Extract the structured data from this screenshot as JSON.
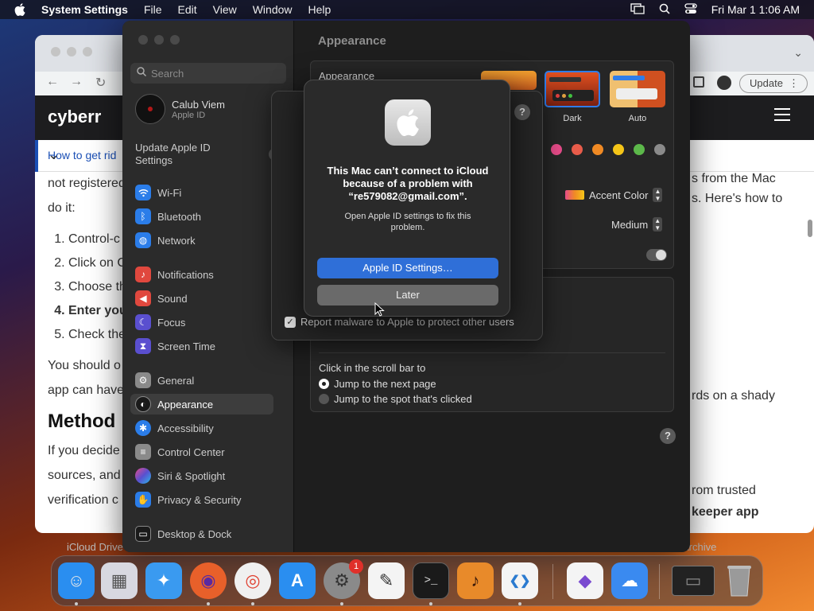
{
  "menubar": {
    "app_name": "System Settings",
    "items": [
      "File",
      "Edit",
      "View",
      "Window",
      "Help"
    ],
    "clock": "Fri Mar 1  1:06 AM"
  },
  "browser": {
    "update_label": "Update",
    "site_logo": "cyberr",
    "breadcrumb": "How to get rid",
    "article": {
      "p1": "not registered… App Store or",
      "p1b": "do it:",
      "steps": [
        "Control-c",
        "Click on C",
        "Choose th",
        "Enter you",
        "Check the"
      ],
      "p2": "You should o",
      "p2b": "app can have",
      "heading": "Method",
      "p3": "If you decide",
      "p3b": "sources, and",
      "p3c": "verification c",
      "right1": "s from the Mac",
      "right2": "s. Here's how to",
      "right3": "rds on a shady",
      "right4": "rom trusted",
      "right5": "keeper app"
    },
    "footer_left": "iCloud Drive",
    "footer_right": "Archive"
  },
  "settings": {
    "search_placeholder": "Search",
    "user_name": "Calub Viem",
    "user_sub": "Apple ID",
    "update_apple_id": "Update Apple ID Settings",
    "update_badge": "1",
    "nav": [
      {
        "label": "Wi-Fi",
        "icon": "wifi-icon",
        "color": "#2b7de9"
      },
      {
        "label": "Bluetooth",
        "icon": "bluetooth-icon",
        "color": "#2b7de9"
      },
      {
        "label": "Network",
        "icon": "globe-icon",
        "color": "#2b7de9"
      },
      {
        "label": "Notifications",
        "icon": "bell-icon",
        "color": "#e0483e"
      },
      {
        "label": "Sound",
        "icon": "speaker-icon",
        "color": "#e0483e"
      },
      {
        "label": "Focus",
        "icon": "moon-icon",
        "color": "#5a4fcf"
      },
      {
        "label": "Screen Time",
        "icon": "hourglass-icon",
        "color": "#5a4fcf"
      },
      {
        "label": "General",
        "icon": "gear-icon",
        "color": "#8a8a8a"
      },
      {
        "label": "Appearance",
        "icon": "appearance-icon",
        "color": "#1a1a1a"
      },
      {
        "label": "Accessibility",
        "icon": "accessibility-icon",
        "color": "#2b7de9"
      },
      {
        "label": "Control Center",
        "icon": "control-center-icon",
        "color": "#8a8a8a"
      },
      {
        "label": "Siri & Spotlight",
        "icon": "siri-icon",
        "color": "#b04fd0"
      },
      {
        "label": "Privacy & Security",
        "icon": "hand-icon",
        "color": "#2b7de9"
      },
      {
        "label": "Desktop & Dock",
        "icon": "dock-icon",
        "color": "#1a1a1a"
      }
    ],
    "page_title": "Appearance",
    "appearance_label": "Appearance",
    "theme_dark": "Dark",
    "theme_auto": "Auto",
    "accent_label": "Accent Color",
    "medium_label": "Medium",
    "scroll_title": "Click in the scroll bar to",
    "scroll_opt1": "Jump to the next page",
    "scroll_opt2": "Jump to the spot that's clicked",
    "accent_colors": [
      "#e84c8a",
      "#e85c4a",
      "#f08a24",
      "#f5c518",
      "#5cb84a",
      "#8a8a8a"
    ]
  },
  "sheet": {
    "report_label": "Report malware to Apple to protect other users"
  },
  "alert": {
    "headline": "This Mac can’t connect to iCloud because of a problem with “re579082@gmail.com”.",
    "message": "Open Apple ID settings to fix this problem.",
    "primary": "Apple ID Settings…",
    "secondary": "Later"
  },
  "dock": {
    "settings_badge": "1",
    "apps": [
      {
        "name": "finder-icon",
        "glyph": "☺",
        "bg": "#2a8ef0"
      },
      {
        "name": "launchpad-icon",
        "glyph": "▦",
        "bg": "#d8d8e0"
      },
      {
        "name": "safari-icon",
        "glyph": "✦",
        "bg": "#3a9af0"
      },
      {
        "name": "firefox-icon",
        "glyph": "◉",
        "bg": "#e8602a"
      },
      {
        "name": "chrome-icon",
        "glyph": "◎",
        "bg": "#f0f0f0"
      },
      {
        "name": "app-store-icon",
        "glyph": "A",
        "bg": "#2a8ef0"
      },
      {
        "name": "system-settings-icon",
        "glyph": "⚙",
        "bg": "#8a8a8a"
      },
      {
        "name": "textedit-icon",
        "glyph": "✎",
        "bg": "#f4f4f4"
      },
      {
        "name": "terminal-icon",
        "glyph": ">_",
        "bg": "#1a1a1a"
      },
      {
        "name": "garageband-icon",
        "glyph": "♪",
        "bg": "#e88a2a"
      },
      {
        "name": "vscode-icon",
        "glyph": "❮❯",
        "bg": "#f4f4f4"
      },
      {
        "name": "visual-studio-icon",
        "glyph": "◆",
        "bg": "#f4f4f4"
      },
      {
        "name": "weather-icon",
        "glyph": "☁",
        "bg": "#3a8af0"
      },
      {
        "name": "screenshot-window-icon",
        "glyph": "▭",
        "bg": "#222"
      },
      {
        "name": "trash-icon",
        "glyph": "🗑",
        "bg": "transparent"
      }
    ]
  }
}
